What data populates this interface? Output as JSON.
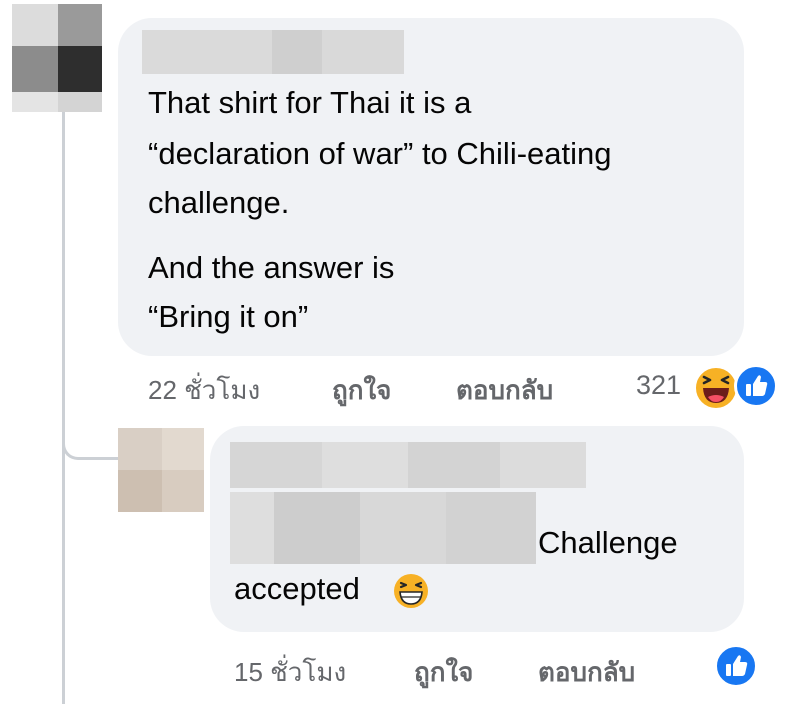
{
  "comment": {
    "text_lines": [
      "That shirt for Thai it is a",
      "“declaration of war” to Chili-eating",
      "challenge.",
      "And the answer is",
      "“Bring it on”"
    ],
    "time": "22 ชั่วโมง",
    "like_label": "ถูกใจ",
    "reply_label": "ตอบกลับ",
    "reaction_count": "321",
    "reactions": [
      "haha-icon",
      "like-icon"
    ]
  },
  "reply": {
    "text_line1": "Challenge",
    "text_line2": "accepted",
    "emoji": "grinning-face-icon",
    "time": "15 ชั่วโมง",
    "like_label": "ถูกใจ",
    "reply_label": "ตอบกลับ",
    "reactions": [
      "like-icon"
    ]
  },
  "colors": {
    "bubble_bg": "#f0f2f5",
    "meta_text": "#65676b",
    "like_blue": "#1877f2",
    "emoji_yellow": "#f7b125"
  }
}
